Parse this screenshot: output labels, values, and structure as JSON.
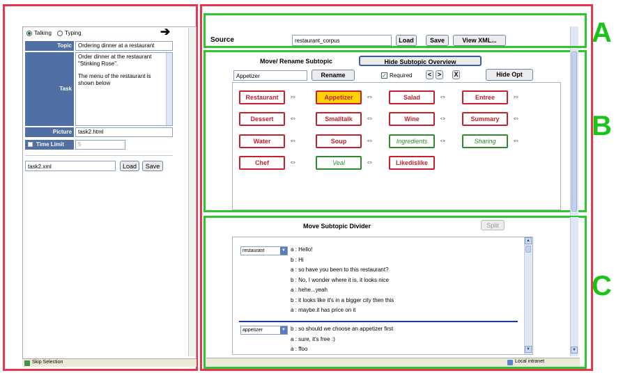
{
  "left": {
    "radio_talking": "Talking",
    "radio_typing": "Typing",
    "topic_label": "Topic",
    "topic_value": "Ordering dinner at a restaurant",
    "task_label": "Task",
    "task_value_1": "Order dinner at the restaurant \"Stinking Rose\".",
    "task_value_2": "The menu of the restaurant is shown below",
    "picture_label": "Picture",
    "picture_value": "task2.html",
    "time_limit_label": "Time Limit",
    "time_limit_value": "5",
    "file_value": "task2.xml",
    "load_label": "Load",
    "save_label": "Save",
    "status_text": "Skip Selection"
  },
  "source": {
    "label": "Source",
    "value": "restaurant_corpus",
    "load_label": "Load",
    "save_label": "Save",
    "view_xml_label": "View XML..."
  },
  "subtopic": {
    "title": "Move/ Rename Subtopic",
    "hide_overview_label": "Hide Subtopic Overview",
    "name_value": "Appetizer",
    "rename_label": "Rename",
    "required_label": "Required",
    "nav_left": "<",
    "nav_right": ">",
    "nav_close": "X",
    "hide_opt_label": "Hide Opt",
    "chips": [
      {
        "label": "Restaurant",
        "style": "red"
      },
      {
        "label": "Appetizer",
        "style": "sel"
      },
      {
        "label": "Salad",
        "style": "red"
      },
      {
        "label": "Entree",
        "style": "red"
      },
      {
        "label": "Dessert",
        "style": "red"
      },
      {
        "label": "Smalltalk",
        "style": "red"
      },
      {
        "label": "Wine",
        "style": "red"
      },
      {
        "label": "Summary",
        "style": "red"
      },
      {
        "label": "Water",
        "style": "red"
      },
      {
        "label": "Soup",
        "style": "red"
      },
      {
        "label": "Ingredients",
        "style": "green"
      },
      {
        "label": "Sharing",
        "style": "green"
      },
      {
        "label": "Chef",
        "style": "red"
      },
      {
        "label": "Veal",
        "style": "green"
      },
      {
        "label": "Likedislike",
        "style": "red"
      }
    ],
    "arrow_glyph": "⇔"
  },
  "divider": {
    "title": "Move Subtopic Divider",
    "split_label": "Split",
    "select_1": "restaurant",
    "select_2": "appetizer",
    "lines_1": [
      "a : Hello!",
      "b : Hi",
      "a : so have you been to this restaurant?",
      "b : No, I wonder where it is, it looks nice",
      "a : hehe...yeah",
      "b : it looks like it's in a bigger city then this",
      "a : maybe.it has price on it"
    ],
    "lines_2": [
      "b : so should we choose an appetizer first",
      "a : sure, it's free :)",
      "a : ffoo"
    ],
    "status_text": "Local intranet"
  },
  "labels": {
    "a": "A",
    "b": "B",
    "c": "C"
  },
  "colors": {
    "red_box": "#e8344e",
    "green_box": "#2ec62e",
    "divider_line": "#1a2fd8",
    "header_blue": "#4f6fa5"
  }
}
